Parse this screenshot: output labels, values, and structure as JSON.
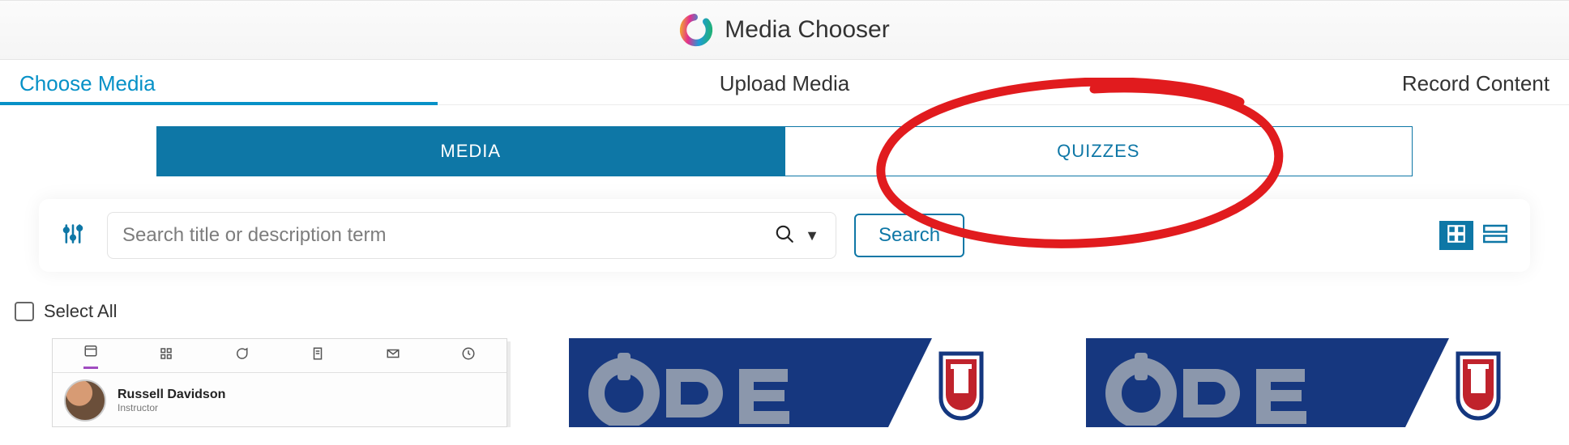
{
  "header": {
    "title": "Media Chooser"
  },
  "mainnav": {
    "choose": "Choose Media",
    "upload": "Upload Media",
    "record": "Record Content"
  },
  "toggle": {
    "media": "MEDIA",
    "quizzes": "QUIZZES"
  },
  "search": {
    "placeholder": "Search title or description term",
    "button": "Search"
  },
  "select_all_label": "Select All",
  "thumb1": {
    "user_name": "Russell Davidson",
    "user_role": "Instructor"
  },
  "annotation": {
    "color": "#e11b1e"
  }
}
